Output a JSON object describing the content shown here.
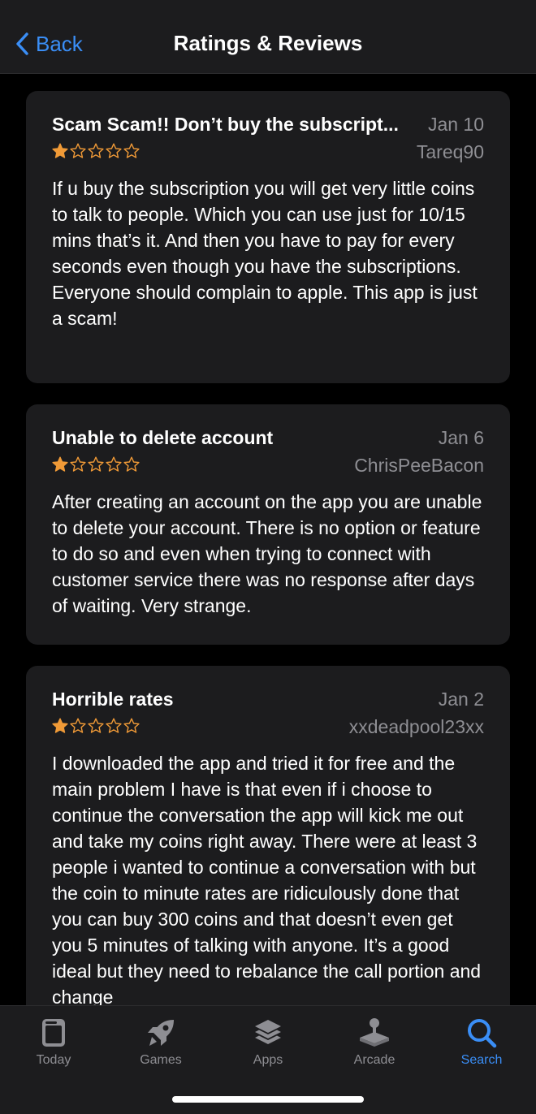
{
  "nav": {
    "back_label": "Back",
    "title": "Ratings & Reviews"
  },
  "reviews": [
    {
      "title": "Scam Scam!! Don’t buy the subscript...",
      "date": "Jan 10",
      "author": "Tareq90",
      "rating": 1,
      "max_rating": 5,
      "body": "If u buy the subscription you will get very little coins to talk to people. Which you can use just for 10/15 mins that’s it. And then you have to pay for every seconds even though you have the subscriptions.\nEveryone should complain to apple. This app is just a scam!"
    },
    {
      "title": "Unable to delete account",
      "date": "Jan 6",
      "author": "ChrisPeeBacon",
      "rating": 1,
      "max_rating": 5,
      "body": "After creating an account on the app you are unable to delete your account. There is no option or feature to do so and even when trying to connect with customer service there was no response after days of waiting. Very strange."
    },
    {
      "title": "Horrible rates",
      "date": "Jan 2",
      "author": "xxdeadpool23xx",
      "rating": 1,
      "max_rating": 5,
      "body": "I downloaded the app and tried it for free and the main problem I have is that even if i choose to continue the conversation the app will kick me out and take my coins right away. There were at least 3 people i wanted to continue a conversation with but the coin to minute rates are ridiculously done that you can buy 300 coins and that doesn’t even get you 5 minutes of talking with anyone. It’s a good ideal but they need to rebalance the call portion and change"
    }
  ],
  "tabs": [
    {
      "label": "Today",
      "icon": "today-icon",
      "active": false
    },
    {
      "label": "Games",
      "icon": "rocket-icon",
      "active": false
    },
    {
      "label": "Apps",
      "icon": "stack-icon",
      "active": false
    },
    {
      "label": "Arcade",
      "icon": "joystick-icon",
      "active": false
    },
    {
      "label": "Search",
      "icon": "search-icon",
      "active": true
    }
  ],
  "colors": {
    "accent": "#3a8ef6",
    "star": "#f09a37",
    "card_bg": "#1c1c1e",
    "secondary_text": "#8e8e93"
  }
}
